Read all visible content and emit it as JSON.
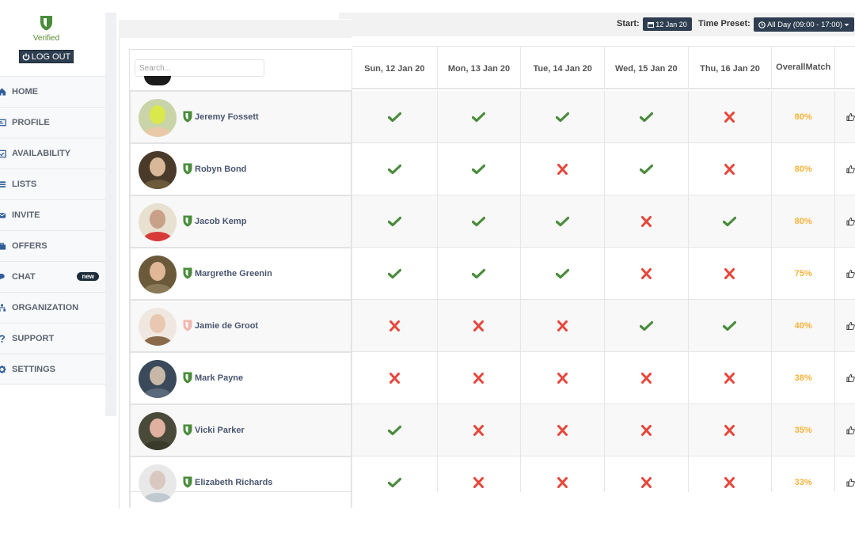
{
  "sidebar": {
    "verified_label": "Verified",
    "logout_label": "LOG OUT",
    "items": [
      {
        "label": "HOME",
        "icon": "home-icon"
      },
      {
        "label": "PROFILE",
        "icon": "id-card-icon"
      },
      {
        "label": "AVAILABILITY",
        "icon": "calendar-check-icon"
      },
      {
        "label": "LISTS",
        "icon": "list-icon"
      },
      {
        "label": "INVITE",
        "icon": "envelope-icon"
      },
      {
        "label": "OFFERS",
        "icon": "briefcase-icon"
      },
      {
        "label": "CHAT",
        "icon": "chat-icon",
        "badge": "new"
      },
      {
        "label": "ORGANIZATION",
        "icon": "sitemap-icon"
      },
      {
        "label": "SUPPORT",
        "icon": "question-icon"
      },
      {
        "label": "SETTINGS",
        "icon": "gear-icon"
      }
    ]
  },
  "toolbar": {
    "start_label": "Start:",
    "start_value": "12 Jan 20",
    "preset_label": "Time Preset:",
    "preset_value": "All Day (09:00 - 17:00)"
  },
  "search": {
    "placeholder": "Search..."
  },
  "colors": {
    "check": "#4a8c3c",
    "cross": "#e8463a",
    "match": "#f6b23a",
    "verified_shield": "#4a8c3c",
    "unverified_shield": "#f2b8b0",
    "button_bg": "#2e3e50"
  },
  "matrix": {
    "columns": [
      "Sun, 12 Jan 20",
      "Mon, 13 Jan 20",
      "Tue, 14 Jan 20",
      "Wed, 15 Jan 20",
      "Thu, 16 Jan 20"
    ],
    "overall_header_line1": "Overall",
    "overall_header_line2": "Match"
  },
  "people": [
    {
      "name": "Jeremy Fossett",
      "verified": true,
      "availability": [
        true,
        true,
        true,
        true,
        false
      ],
      "match": "80%"
    },
    {
      "name": "Robyn Bond",
      "verified": true,
      "availability": [
        true,
        true,
        false,
        true,
        false
      ],
      "match": "80%"
    },
    {
      "name": "Jacob Kemp",
      "verified": true,
      "availability": [
        true,
        true,
        true,
        false,
        true
      ],
      "match": "80%"
    },
    {
      "name": "Margrethe Greenin",
      "verified": true,
      "availability": [
        true,
        true,
        true,
        false,
        false
      ],
      "match": "75%"
    },
    {
      "name": "Jamie de Groot",
      "verified": false,
      "availability": [
        false,
        false,
        false,
        true,
        true
      ],
      "match": "40%"
    },
    {
      "name": "Mark Payne",
      "verified": true,
      "availability": [
        false,
        false,
        false,
        false,
        false
      ],
      "match": "38%"
    },
    {
      "name": "Vicki Parker",
      "verified": true,
      "availability": [
        true,
        false,
        false,
        false,
        false
      ],
      "match": "35%"
    },
    {
      "name": "Elizabeth Richards",
      "verified": true,
      "availability": [
        true,
        false,
        false,
        false,
        false
      ],
      "match": "33%"
    }
  ]
}
